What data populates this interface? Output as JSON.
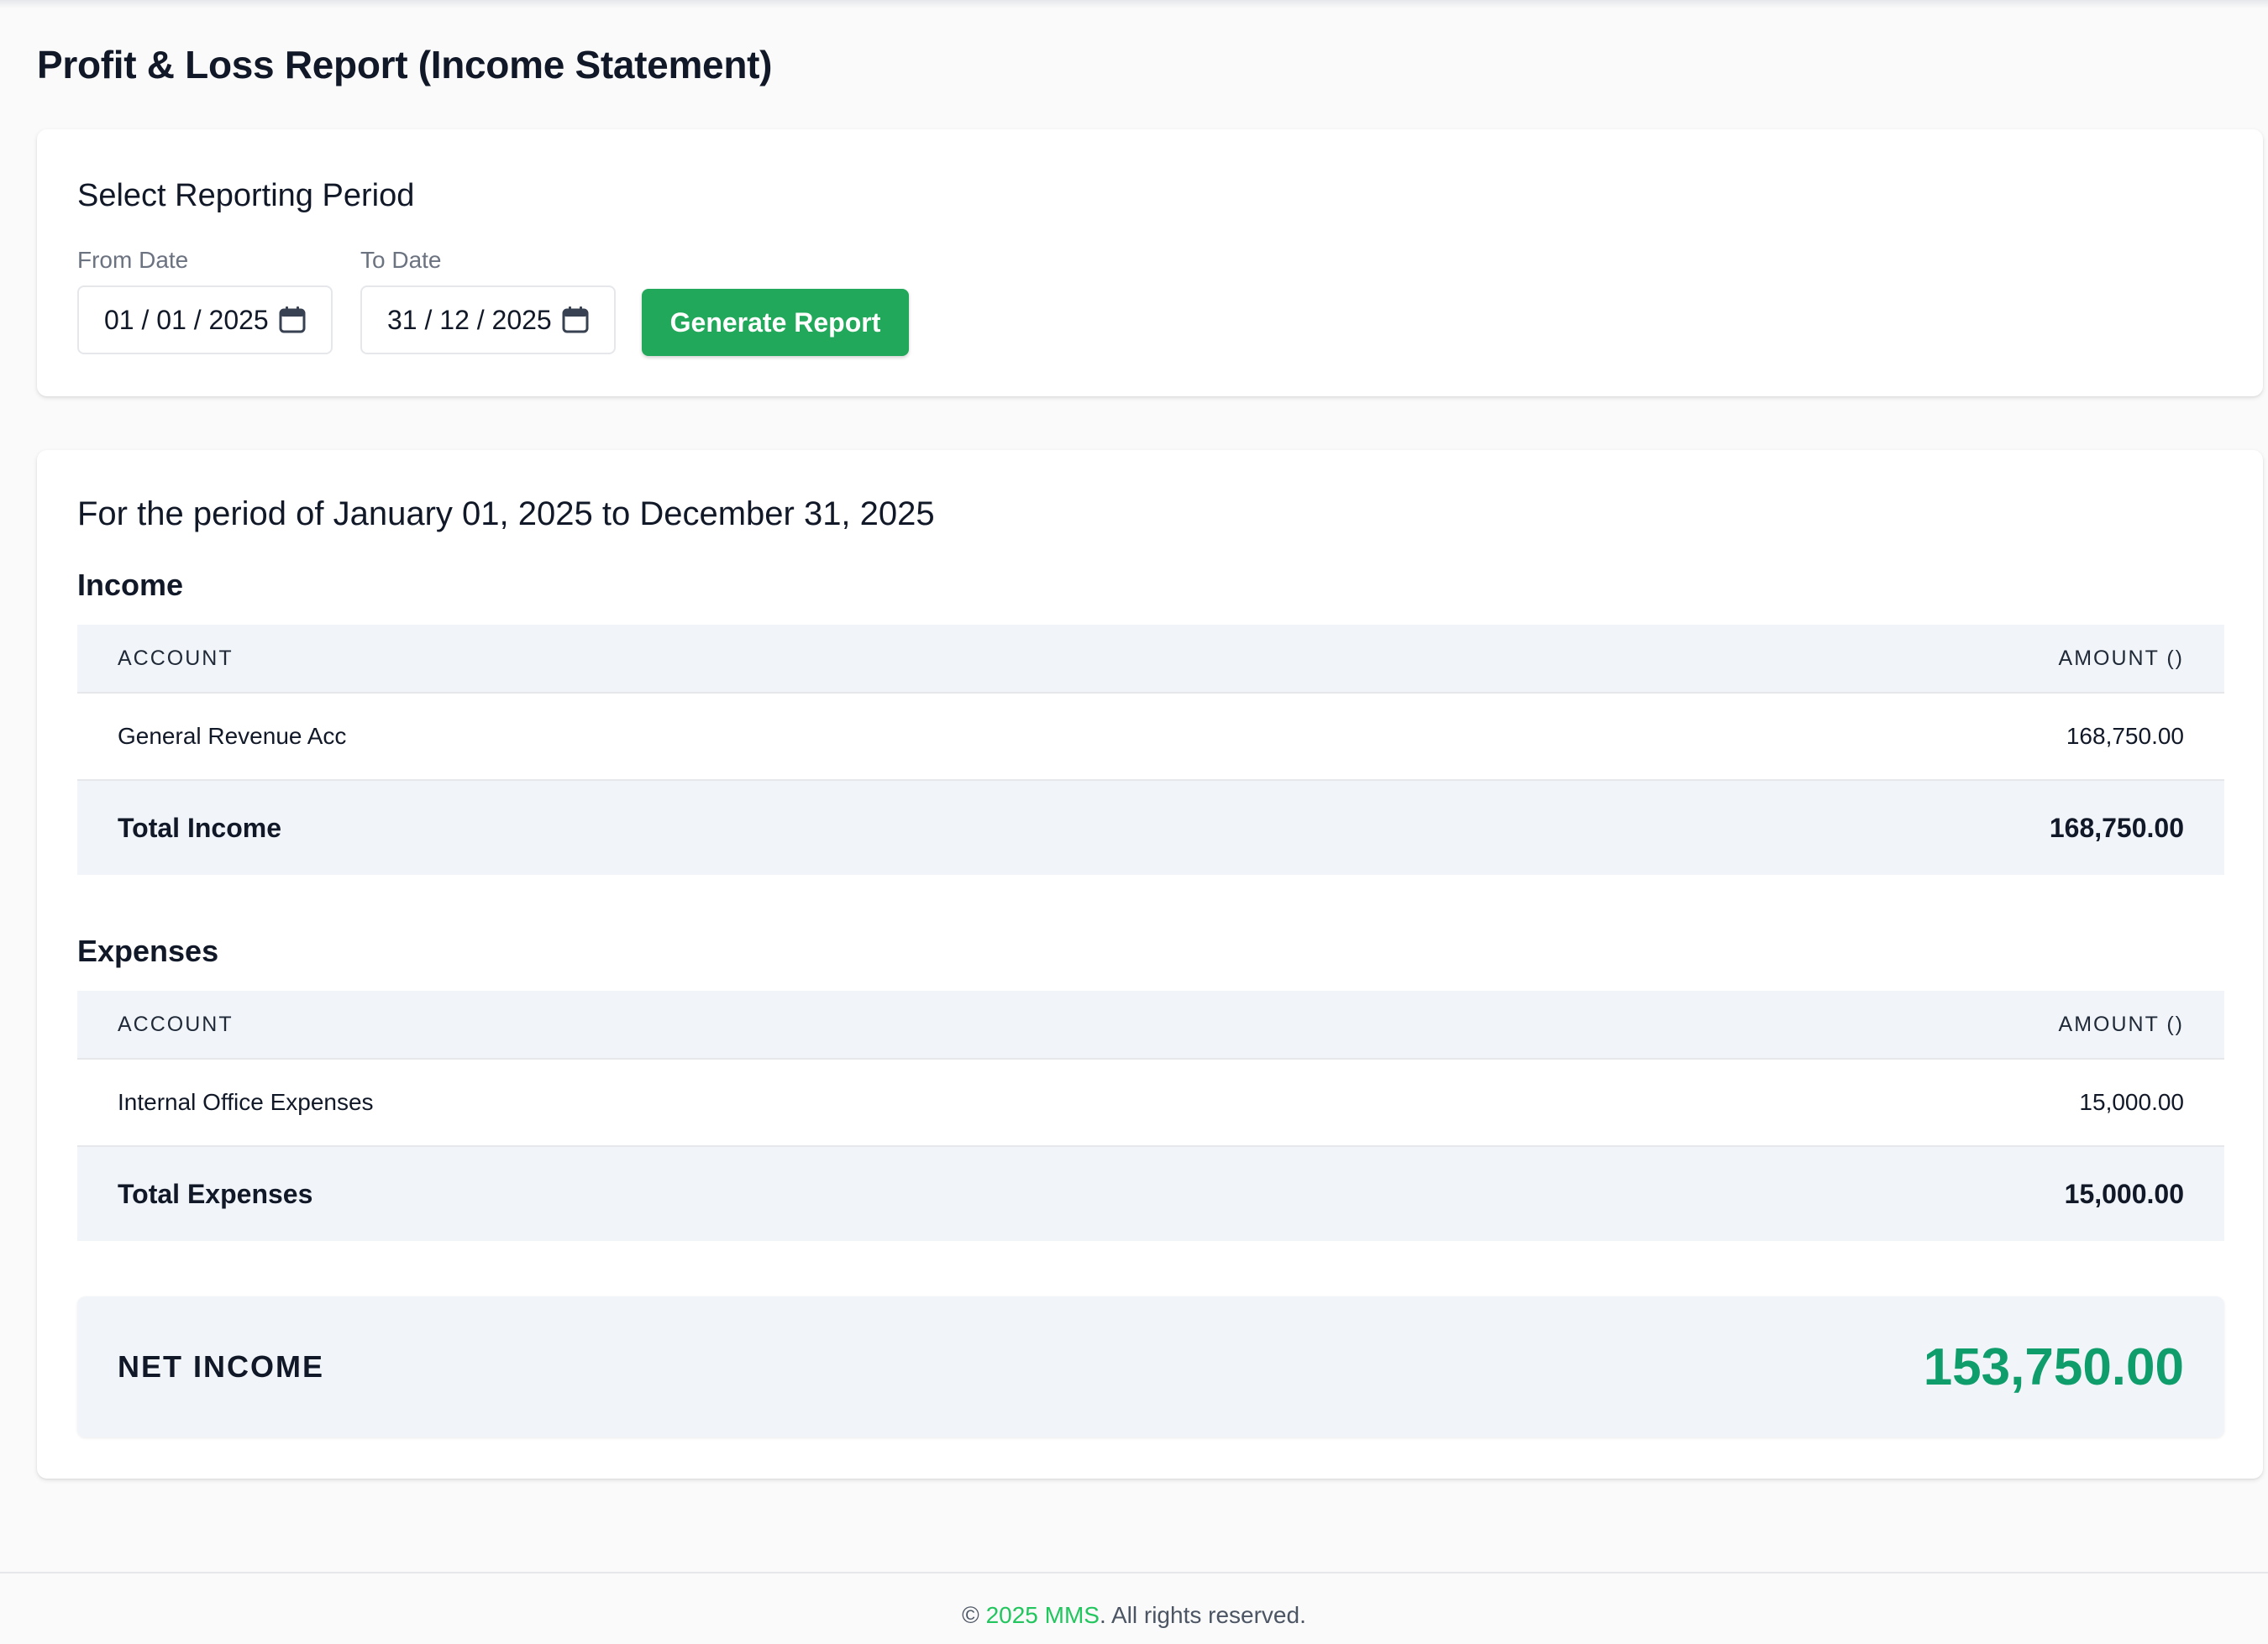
{
  "page": {
    "title": "Profit & Loss Report (Income Statement)"
  },
  "filter": {
    "title": "Select Reporting Period",
    "from_label": "From Date",
    "from_value": "01 / 01 / 2025",
    "to_label": "To Date",
    "to_value": "31 / 12 / 2025",
    "generate_label": "Generate Report",
    "accent_color": "#22a85a"
  },
  "report": {
    "period_text": "For the period of January 01, 2025 to December 31, 2025",
    "income": {
      "title": "Income",
      "col_account": "ACCOUNT",
      "col_amount": "AMOUNT ()",
      "rows": [
        {
          "account": "General Revenue Acc",
          "amount": "168,750.00"
        }
      ],
      "total_label": "Total Income",
      "total_value": "168,750.00"
    },
    "expenses": {
      "title": "Expenses",
      "col_account": "ACCOUNT",
      "col_amount": "AMOUNT ()",
      "rows": [
        {
          "account": "Internal Office Expenses",
          "amount": "15,000.00"
        }
      ],
      "total_label": "Total Expenses",
      "total_value": "15,000.00"
    },
    "net": {
      "label": "NET INCOME",
      "value": "153,750.00",
      "color": "#0f9d6b"
    }
  },
  "footer": {
    "copyright": "©",
    "brand": "2025 MMS",
    "rest": ". All rights reserved."
  }
}
